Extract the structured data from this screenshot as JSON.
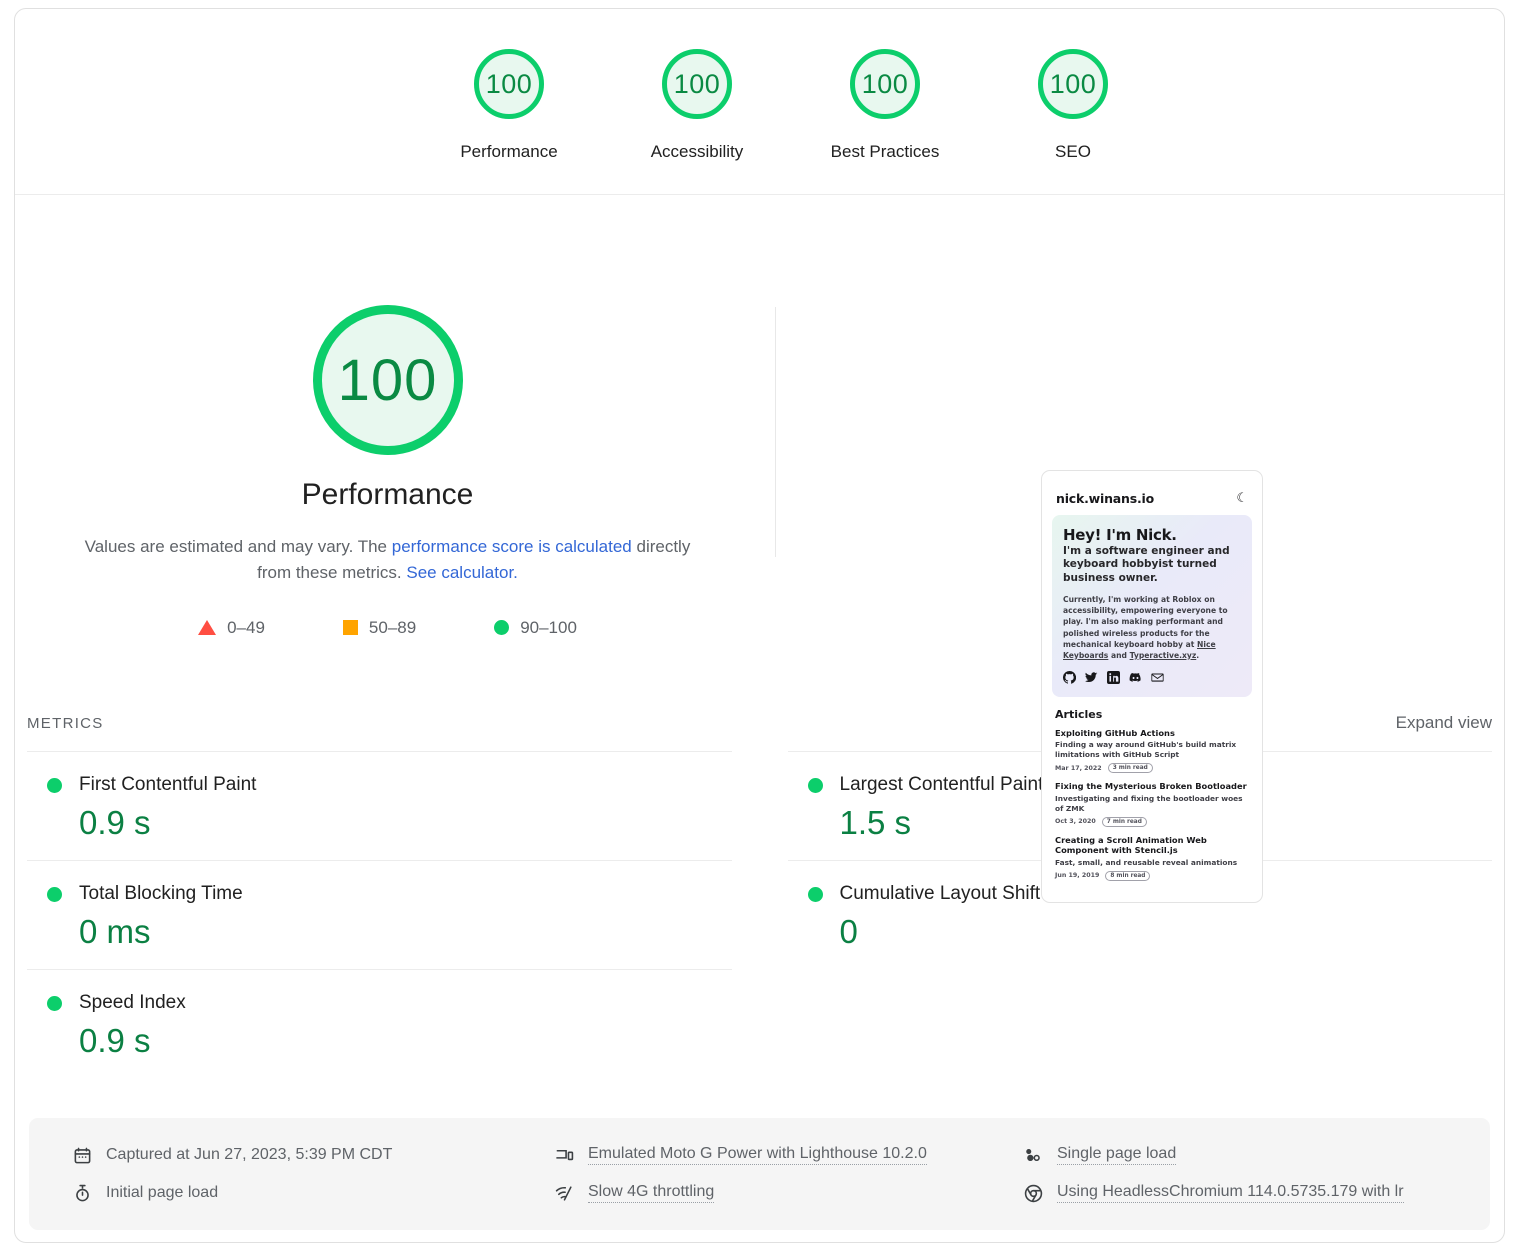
{
  "category_scores": [
    {
      "score": "100",
      "label": "Performance"
    },
    {
      "score": "100",
      "label": "Accessibility"
    },
    {
      "score": "100",
      "label": "Best Practices"
    },
    {
      "score": "100",
      "label": "SEO"
    }
  ],
  "performance": {
    "score": "100",
    "title": "Performance",
    "desc_part1": "Values are estimated and may vary. The ",
    "desc_link1": "performance score is calculated",
    "desc_part2": " directly from these metrics. ",
    "desc_link2": "See calculator.",
    "legend": [
      {
        "marker": "triangle-red",
        "range": "0–49"
      },
      {
        "marker": "square-orange",
        "range": "50–89"
      },
      {
        "marker": "circle-green",
        "range": "90–100"
      }
    ]
  },
  "thumbnail": {
    "site": "nick.winans.io",
    "moon_icon": "☾",
    "hero_title": "Hey! I'm Nick.",
    "hero_subtitle": "I'm a software engineer and keyboard hobbyist turned business owner.",
    "hero_body_1": "Currently, I'm working at Roblox on accessibility, empowering everyone to play. I'm also making performant and polished wireless products for the mechanical keyboard hobby at ",
    "hero_body_link1": "Nice Keyboards",
    "hero_body_2": " and ",
    "hero_body_link2": "Typeractive.xyz",
    "hero_body_3": ".",
    "social_icons": [
      "github-icon",
      "twitter-icon",
      "linkedin-icon",
      "discord-icon",
      "email-icon"
    ],
    "articles_heading": "Articles",
    "articles": [
      {
        "title": "Exploiting GitHub Actions",
        "desc": "Finding a way around GitHub's build matrix limitations with GitHub Script",
        "date": "Mar 17, 2022",
        "read": "3 min read"
      },
      {
        "title": "Fixing the Mysterious Broken Bootloader",
        "desc": "Investigating and fixing the bootloader woes of ZMK",
        "date": "Oct 3, 2020",
        "read": "7 min read"
      },
      {
        "title": "Creating a Scroll Animation Web Component with Stencil.js",
        "desc": "Fast, small, and reusable reveal animations",
        "date": "Jun 19, 2019",
        "read": "8 min read"
      }
    ]
  },
  "metrics_section": {
    "heading": "METRICS",
    "expand_view": "Expand view",
    "metrics": [
      {
        "name": "First Contentful Paint",
        "value": "0.9 s",
        "status": "pass"
      },
      {
        "name": "Largest Contentful Paint",
        "value": "1.5 s",
        "status": "pass"
      },
      {
        "name": "Total Blocking Time",
        "value": "0 ms",
        "status": "pass"
      },
      {
        "name": "Cumulative Layout Shift",
        "value": "0",
        "status": "pass"
      },
      {
        "name": "Speed Index",
        "value": "0.9 s",
        "status": "pass"
      }
    ]
  },
  "footer": {
    "captured_at": "Captured at Jun 27, 2023, 5:39 PM CDT",
    "page_load": "Initial page load",
    "device": "Emulated Moto G Power with Lighthouse 10.2.0",
    "throttling": "Slow 4G throttling",
    "load_type": "Single page load",
    "user_agent": "Using HeadlessChromium 114.0.5735.179 with lr"
  },
  "colors": {
    "pass_green": "#0cce6b",
    "pass_text_green": "#0b8043",
    "average_orange": "#ffa400",
    "fail_red": "#ff4e42",
    "link_blue": "#3367d6"
  }
}
